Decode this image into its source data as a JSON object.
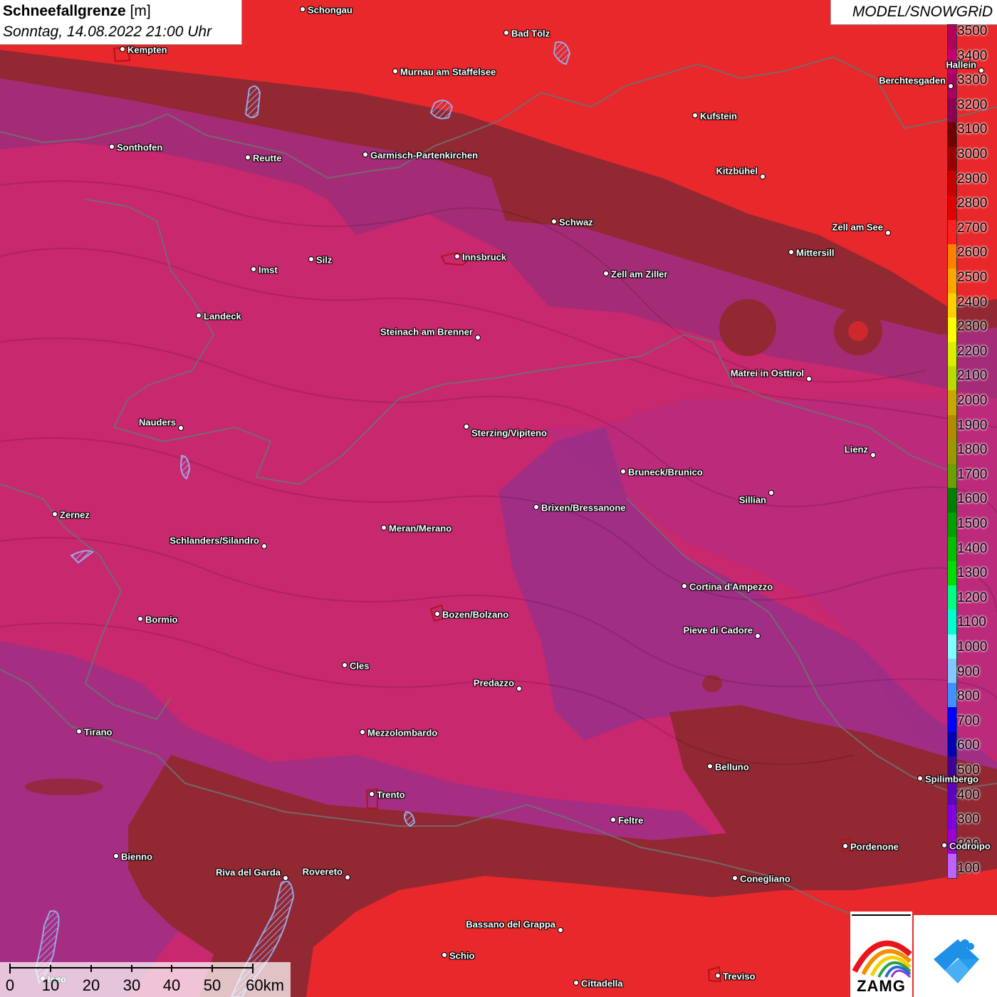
{
  "title": {
    "name": "Schneefallgrenze",
    "unit": "[m]",
    "date": "Sonntag, 14.08.2022 21:00 Uhr"
  },
  "model_label": "MODEL/SNOWGRiD",
  "legend": {
    "labels": [
      "3500",
      "3400",
      "3300",
      "3200",
      "3100",
      "3000",
      "2900",
      "2800",
      "2700",
      "2600",
      "2500",
      "2400",
      "2300",
      "2200",
      "2100",
      "2000",
      "1900",
      "1800",
      "1700",
      "1600",
      "1500",
      "1400",
      "1300",
      "1200",
      "1100",
      "1000",
      "900",
      "800",
      "700",
      "600",
      "500",
      "400",
      "300",
      "200",
      "100"
    ],
    "colors": [
      "#b2005d",
      "#c2006f",
      "#a80062",
      "#8c0050",
      "#6e0000",
      "#9b0000",
      "#c40000",
      "#e10000",
      "#ff2020",
      "#ff7f00",
      "#ffa500",
      "#ffd000",
      "#ffff00",
      "#d8f000",
      "#b9dc00",
      "#c8a800",
      "#b08c00",
      "#999900",
      "#6aa000",
      "#008000",
      "#00a000",
      "#00c000",
      "#00de00",
      "#00ff80",
      "#00ffd0",
      "#80ffff",
      "#80c8ff",
      "#4090ff",
      "#0000ff",
      "#0000b0",
      "#400090",
      "#6000c0",
      "#8000e0",
      "#a000d0",
      "#c060ff"
    ]
  },
  "cities": [
    {
      "name": "Schongau"
    },
    {
      "name": "Bad Tölz"
    },
    {
      "name": "Kempten"
    },
    {
      "name": "Murnau am Staffelsee"
    },
    {
      "name": "Hallein"
    },
    {
      "name": "Berchtesgaden"
    },
    {
      "name": "Kufstein"
    },
    {
      "name": "Sonthofen"
    },
    {
      "name": "Reutte"
    },
    {
      "name": "Garmisch-Partenkirchen"
    },
    {
      "name": "Kitzbühel"
    },
    {
      "name": "Schwaz"
    },
    {
      "name": "Zell am See"
    },
    {
      "name": "Mittersill"
    },
    {
      "name": "Innsbruck"
    },
    {
      "name": "Imst"
    },
    {
      "name": "Silz"
    },
    {
      "name": "Zell am Ziller"
    },
    {
      "name": "Landeck"
    },
    {
      "name": "Steinach am Brenner"
    },
    {
      "name": "Matrei in Osttirol"
    },
    {
      "name": "Nauders"
    },
    {
      "name": "Sterzing/Vipiteno"
    },
    {
      "name": "Lienz"
    },
    {
      "name": "Bruneck/Brunico"
    },
    {
      "name": "Sillian"
    },
    {
      "name": "Brixen/Bressanone"
    },
    {
      "name": "Zernez"
    },
    {
      "name": "Meran/Merano"
    },
    {
      "name": "Schlanders/Silandro"
    },
    {
      "name": "Cortina d'Ampezzo"
    },
    {
      "name": "Bozen/Bolzano"
    },
    {
      "name": "Bormio"
    },
    {
      "name": "Pieve di Cadore"
    },
    {
      "name": "Cles"
    },
    {
      "name": "Predazzo"
    },
    {
      "name": "Tirano"
    },
    {
      "name": "Mezzolombardo"
    },
    {
      "name": "Belluno"
    },
    {
      "name": "Spilimbergo"
    },
    {
      "name": "Trento"
    },
    {
      "name": "Feltre"
    },
    {
      "name": "Pordenone"
    },
    {
      "name": "Codroipo"
    },
    {
      "name": "Bienno"
    },
    {
      "name": "Riva del Garda"
    },
    {
      "name": "Rovereto"
    },
    {
      "name": "Conegliano"
    },
    {
      "name": "Bassano del Grappa"
    },
    {
      "name": "Schio"
    },
    {
      "name": "Treviso"
    },
    {
      "name": "Cittadella"
    },
    {
      "name": "Iseo"
    }
  ],
  "scale": {
    "labels": [
      "0",
      "10",
      "20",
      "30",
      "40",
      "50",
      "60km"
    ]
  },
  "logos": {
    "zamg": "ZAMG"
  },
  "icons": [
    "zamg-rainbow-logo-icon",
    "snowgrid-app-logo-icon"
  ]
}
